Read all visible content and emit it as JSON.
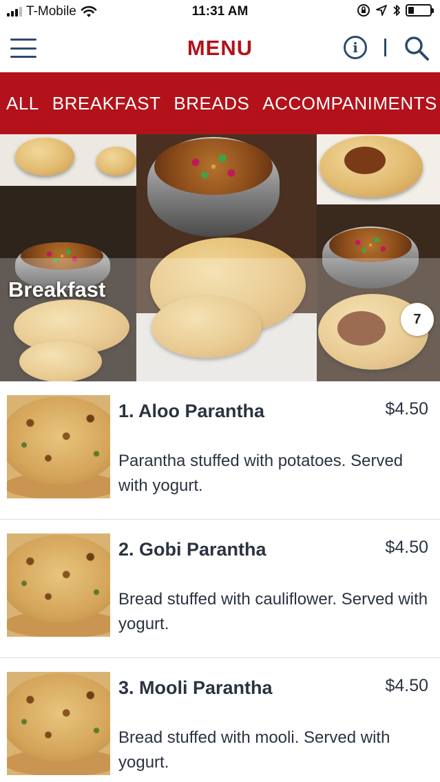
{
  "status_bar": {
    "carrier": "T-Mobile",
    "time": "11:31 AM",
    "signal_bars": 3,
    "battery_level": 0.25
  },
  "header": {
    "title": "MENU",
    "info_icon": "info-icon",
    "search_icon": "search-icon",
    "menu_icon": "hamburger-icon"
  },
  "categories": [
    {
      "label": "ALL"
    },
    {
      "label": "BREAKFAST"
    },
    {
      "label": "BREADS"
    },
    {
      "label": "ACCOMPANIMENTS"
    }
  ],
  "hero": {
    "title": "Breakfast",
    "item_count": "7"
  },
  "items": [
    {
      "name": "1. Aloo Parantha",
      "price": "$4.50",
      "description": "Parantha stuffed with potatoes. Served with yogurt."
    },
    {
      "name": "2. Gobi Parantha",
      "price": "$4.50",
      "description": "Bread stuffed with cauliflower. Served with yogurt."
    },
    {
      "name": "3. Mooli Parantha",
      "price": "$4.50",
      "description": "Bread stuffed with mooli. Served with yogurt."
    }
  ],
  "colors": {
    "brand_red": "#b3121a",
    "navy": "#2b4a6b",
    "text": "#2b3340"
  }
}
